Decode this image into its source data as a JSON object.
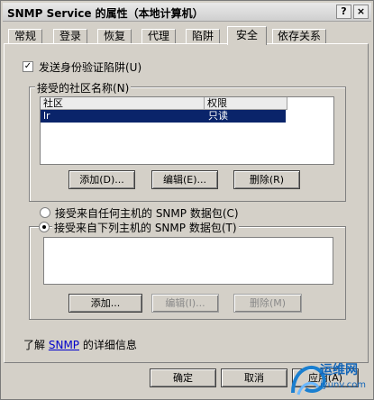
{
  "window": {
    "title": "SNMP Service 的属性（本地计算机）",
    "help_glyph": "?",
    "close_glyph": "×"
  },
  "tabs": [
    {
      "label": "常规"
    },
    {
      "label": "登录"
    },
    {
      "label": "恢复"
    },
    {
      "label": "代理"
    },
    {
      "label": "陷阱"
    },
    {
      "label": "安全"
    },
    {
      "label": "依存关系"
    }
  ],
  "active_tab": "安全",
  "auth_trap": {
    "label": "发送身份验证陷阱(U)",
    "checked": true,
    "check_glyph": "✓"
  },
  "communities": {
    "group_label": "接受的社区名称(N)",
    "columns": [
      "社区",
      "权限"
    ],
    "rows": [
      {
        "community": "lr",
        "rights": "只读"
      }
    ],
    "buttons": {
      "add": "添加(D)...",
      "edit": "编辑(E)...",
      "remove": "删除(R)"
    }
  },
  "hosts": {
    "any_label": "接受来自任何主机的 SNMP 数据包(C)",
    "list_label": "接受来自下列主机的 SNMP 数据包(T)",
    "selected": "list",
    "buttons": {
      "add": "添加...",
      "edit": "编辑(I)...",
      "remove": "删除(M)"
    }
  },
  "learn_more": {
    "prefix": "了解",
    "link": "SNMP",
    "suffix": "的详细信息"
  },
  "footer": {
    "ok": "确定",
    "cancel": "取消",
    "apply": "应用(A)"
  },
  "watermark": {
    "main": "运维网",
    "sub": "iyunv.com"
  }
}
